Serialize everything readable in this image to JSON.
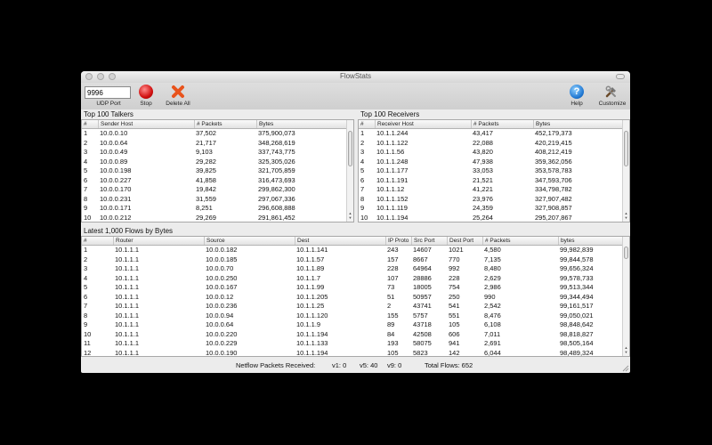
{
  "window": {
    "title": "FlowStats"
  },
  "toolbar": {
    "udp_port_value": "9996",
    "udp_port_label": "UDP Port",
    "stop_label": "Stop",
    "delete_all_label": "Delete All",
    "help_label": "Help",
    "customize_label": "Customize",
    "stop_color": "#d11010",
    "delete_color": "#e8531c",
    "help_glyph": "?"
  },
  "talkers": {
    "title": "Top 100 Talkers",
    "headers": [
      "#",
      "Sender Host",
      "# Packets",
      "Bytes"
    ],
    "rows": [
      [
        "1",
        "10.0.0.10",
        "37,502",
        "375,900,073"
      ],
      [
        "2",
        "10.0.0.64",
        "21,717",
        "348,268,619"
      ],
      [
        "3",
        "10.0.0.49",
        "9,103",
        "337,743,775"
      ],
      [
        "4",
        "10.0.0.89",
        "29,282",
        "325,305,026"
      ],
      [
        "5",
        "10.0.0.198",
        "39,825",
        "321,705,859"
      ],
      [
        "6",
        "10.0.0.227",
        "41,858",
        "316,473,693"
      ],
      [
        "7",
        "10.0.0.170",
        "19,842",
        "299,862,300"
      ],
      [
        "8",
        "10.0.0.231",
        "31,559",
        "297,067,336"
      ],
      [
        "9",
        "10.0.0.171",
        "8,251",
        "296,608,888"
      ],
      [
        "10",
        "10.0.0.212",
        "29,269",
        "291,861,452"
      ]
    ]
  },
  "receivers": {
    "title": "Top 100 Receivers",
    "headers": [
      "#",
      "Receiver Host",
      "# Packets",
      "Bytes"
    ],
    "rows": [
      [
        "1",
        "10.1.1.244",
        "43,417",
        "452,179,373"
      ],
      [
        "2",
        "10.1.1.122",
        "22,088",
        "420,219,415"
      ],
      [
        "3",
        "10.1.1.56",
        "43,820",
        "408,212,419"
      ],
      [
        "4",
        "10.1.1.248",
        "47,938",
        "359,362,056"
      ],
      [
        "5",
        "10.1.1.177",
        "33,053",
        "353,578,783"
      ],
      [
        "6",
        "10.1.1.191",
        "21,521",
        "347,593,706"
      ],
      [
        "7",
        "10.1.1.12",
        "41,221",
        "334,798,782"
      ],
      [
        "8",
        "10.1.1.152",
        "23,976",
        "327,907,482"
      ],
      [
        "9",
        "10.1.1.119",
        "24,359",
        "327,908,857"
      ],
      [
        "10",
        "10.1.1.194",
        "25,264",
        "295,207,867"
      ]
    ]
  },
  "flows": {
    "title": "Latest 1,000 Flows by Bytes",
    "headers": [
      "#",
      "Router",
      "Source",
      "Dest",
      "IP Proto",
      "Src Port",
      "Dest Port",
      "# Packets",
      "bytes"
    ],
    "rows": [
      [
        "1",
        "10.1.1.1",
        "10.0.0.182",
        "10.1.1.141",
        "243",
        "14607",
        "1021",
        "4,580",
        "99,982,839"
      ],
      [
        "2",
        "10.1.1.1",
        "10.0.0.185",
        "10.1.1.57",
        "157",
        "8667",
        "770",
        "7,135",
        "99,844,578"
      ],
      [
        "3",
        "10.1.1.1",
        "10.0.0.70",
        "10.1.1.89",
        "228",
        "64964",
        "992",
        "8,480",
        "99,656,324"
      ],
      [
        "4",
        "10.1.1.1",
        "10.0.0.250",
        "10.1.1.7",
        "107",
        "28886",
        "228",
        "2,629",
        "99,578,733"
      ],
      [
        "5",
        "10.1.1.1",
        "10.0.0.167",
        "10.1.1.99",
        "73",
        "18005",
        "754",
        "2,986",
        "99,513,344"
      ],
      [
        "6",
        "10.1.1.1",
        "10.0.0.12",
        "10.1.1.205",
        "51",
        "50957",
        "250",
        "990",
        "99,344,494"
      ],
      [
        "7",
        "10.1.1.1",
        "10.0.0.236",
        "10.1.1.25",
        "2",
        "43741",
        "541",
        "2,542",
        "99,161,517"
      ],
      [
        "8",
        "10.1.1.1",
        "10.0.0.94",
        "10.1.1.120",
        "155",
        "5757",
        "551",
        "8,476",
        "99,050,021"
      ],
      [
        "9",
        "10.1.1.1",
        "10.0.0.64",
        "10.1.1.9",
        "89",
        "43718",
        "105",
        "6,108",
        "98,848,642"
      ],
      [
        "10",
        "10.1.1.1",
        "10.0.0.220",
        "10.1.1.194",
        "84",
        "42508",
        "606",
        "7,011",
        "98,818,827"
      ],
      [
        "11",
        "10.1.1.1",
        "10.0.0.229",
        "10.1.1.133",
        "193",
        "58075",
        "941",
        "2,691",
        "98,505,164"
      ],
      [
        "12",
        "10.1.1.1",
        "10.0.0.190",
        "10.1.1.194",
        "105",
        "5823",
        "142",
        "6,044",
        "98,489,324"
      ]
    ]
  },
  "status": {
    "packets_label": "Netflow Packets Received:",
    "v1": "v1: 0",
    "v5": "v5: 40",
    "v9": "v9: 0",
    "total_flows": "Total Flows: 652"
  }
}
